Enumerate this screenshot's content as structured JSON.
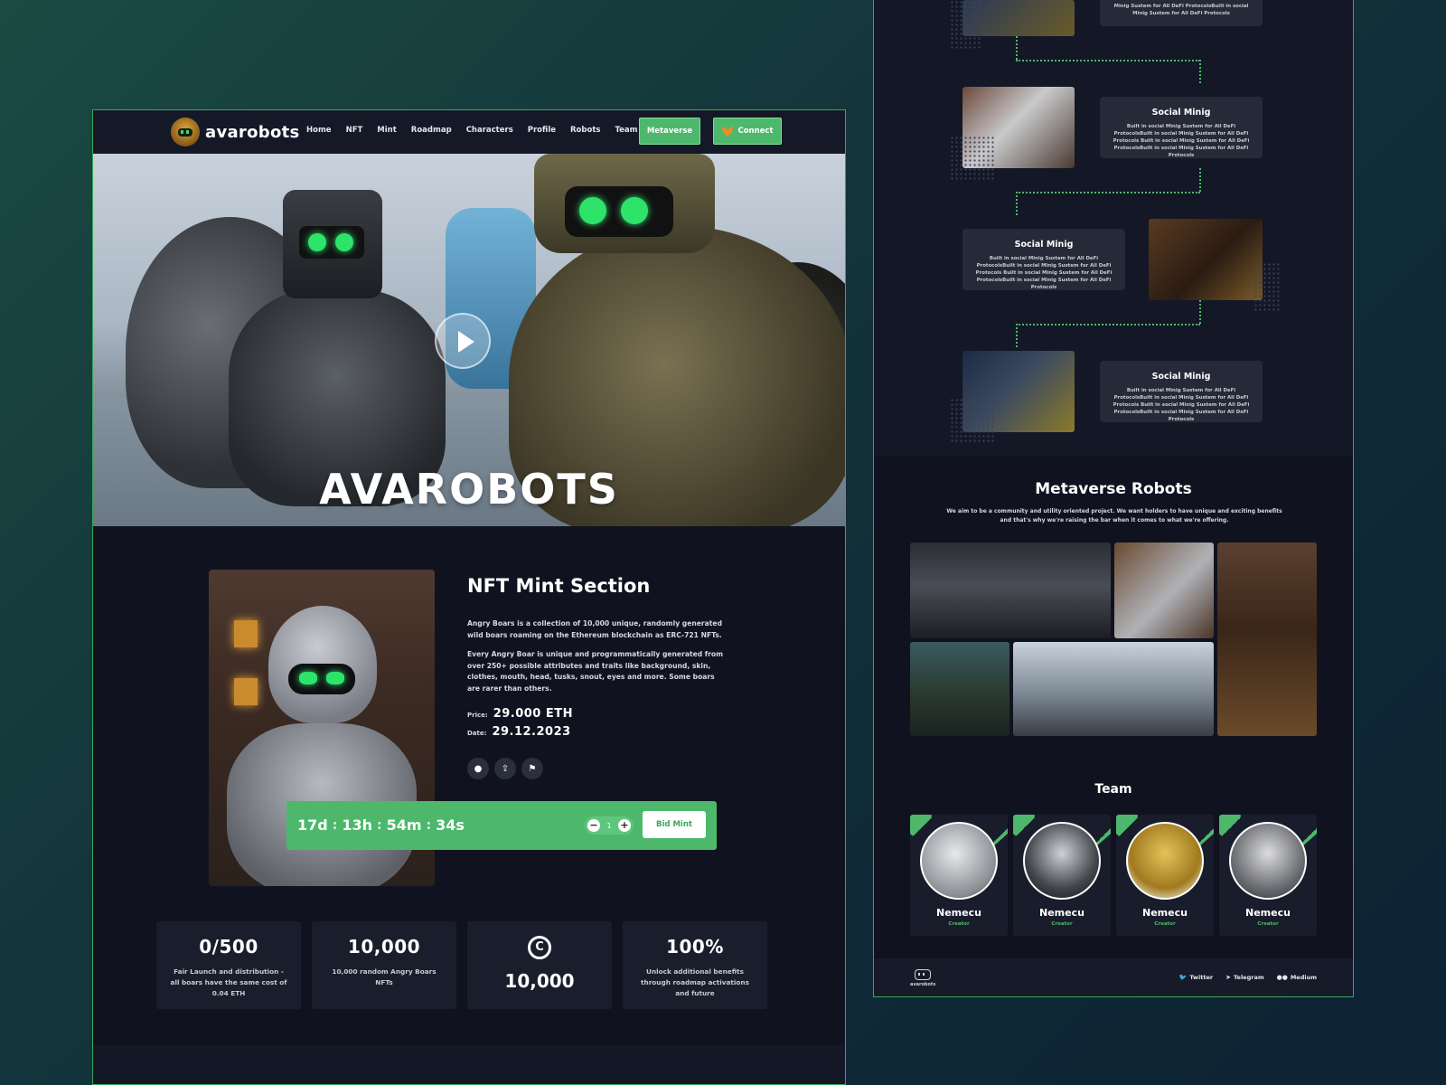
{
  "left": {
    "nav": {
      "logo_text": "avarobots",
      "links": [
        "Home",
        "NFT",
        "Mint",
        "Roadmap",
        "Characters",
        "Profile",
        "Robots",
        "Team"
      ],
      "metaverse_label": "Metaverse",
      "connect_label": "Connect"
    },
    "hero": {
      "title": "AVAROBOTS"
    },
    "mint": {
      "title": "NFT Mint Section",
      "paragraph1": "Angry Boars is a collection of 10,000 unique, randomly generated wild boars roaming on the Ethereum blockchain as ERC-721 NFTs.",
      "paragraph2": "Every Angry Boar is unique and programmatically generated from over 250+ possible attributes and traits like background, skin, clothes, mouth, head, tusks, snout, eyes and more. Some boars are rarer than others.",
      "price_label": "Price:",
      "price_value": "29.000 ETH",
      "date_label": "Date:",
      "date_value": "29.12.2023",
      "countdown": {
        "days": "17d",
        "hours": "13h",
        "minutes": "54m",
        "seconds": "34s",
        "separator": ":"
      },
      "quantity": "1",
      "minus": "−",
      "plus": "+",
      "bid_label": "Bid Mint"
    },
    "stats": [
      {
        "big": "0/500",
        "small": "Fair Launch and distribution - all boars have the same cost of 0.04 ETH"
      },
      {
        "big": "10,000",
        "small": "10,000 random Angry Boars NFTs"
      },
      {
        "big": "10,000",
        "icon": "copyright-icon",
        "symbol": "C"
      },
      {
        "big": "100%",
        "small": "Unlock additional benefits through roadmap activations and future"
      }
    ]
  },
  "right": {
    "roadmap_top_text": "Minig Sustem for All DeFi ProtocolsBuilt in social Minig Sustem for All DeFi Protocols",
    "roadmap_cards": [
      {
        "title": "Social Minig",
        "text": "Built in social Minig Sustem for All DeFi ProtocolsBuilt in social Minig Sustem for All DeFi Protocols Built in social Minig Sustem for All DeFi ProtocolsBuilt in social Minig Sustem for All DeFi Protocols"
      },
      {
        "title": "Social Minig",
        "text": "Built in social Minig Sustem for All DeFi ProtocolsBuilt in social Minig Sustem for All DeFi Protocols Built in social Minig Sustem for All DeFi ProtocolsBuilt in social Minig Sustem for All DeFi Protocols"
      },
      {
        "title": "Social Minig",
        "text": "Built in social Minig Sustem for All DeFi ProtocolsBuilt in social Minig Sustem for All DeFi Protocols Built in social Minig Sustem for All DeFi ProtocolsBuilt in social Minig Sustem for All DeFi Protocols"
      }
    ],
    "metaverse": {
      "title": "Metaverse Robots",
      "subtitle": "We aim to be a community and utility oriented project. We want holders to have unique and exciting benefits and that's why we're raising the bar when it comes to what we're offering."
    },
    "team": {
      "title": "Team",
      "members": [
        {
          "name": "Nemecu",
          "role": "Creator"
        },
        {
          "name": "Nemecu",
          "role": "Creator"
        },
        {
          "name": "Nemecu",
          "role": "Creator"
        },
        {
          "name": "Nemecu",
          "role": "Creator"
        }
      ]
    },
    "footer": {
      "logo_text": "avarobots",
      "socials": [
        {
          "label": "Twitter",
          "icon": "twitter-icon"
        },
        {
          "label": "Telegram",
          "icon": "telegram-icon"
        },
        {
          "label": "Medium",
          "icon": "medium-icon"
        }
      ]
    }
  },
  "colors": {
    "accent": "#4db86b",
    "background": "#10131f",
    "card": "#1a1e2c"
  }
}
